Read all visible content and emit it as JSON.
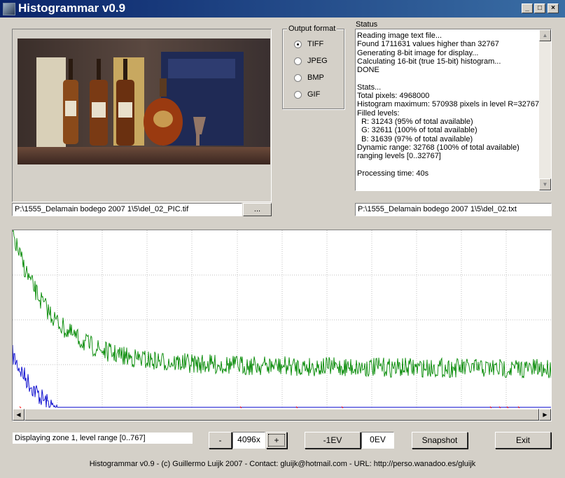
{
  "window": {
    "title": "Histogrammar v0.9",
    "controls": [
      "_",
      "□",
      "×"
    ]
  },
  "preview": {
    "file_path": "P:\\1555_Delamain bodego 2007 1\\5\\del_02_PIC.tif",
    "browse_label": "..."
  },
  "output_format": {
    "legend": "Output format",
    "options": [
      {
        "label": "TIFF",
        "selected": true
      },
      {
        "label": "JPEG",
        "selected": false
      },
      {
        "label": "BMP",
        "selected": false
      },
      {
        "label": "GIF",
        "selected": false
      }
    ]
  },
  "status": {
    "label": "Status",
    "lines": [
      "Reading image text file...",
      "Found 1711631 values higher than 32767",
      "Generating 8-bit image for display...",
      "Calculating 16-bit (true 15-bit) histogram...",
      "DONE",
      "",
      "Stats...",
      "Total pixels: 4968000",
      "Histogram maximum: 570938 pixels in level R=32767",
      "Filled levels:",
      "  R: 31243 (95% of total available)",
      "  G: 32611 (100% of total available)",
      "  B: 31639 (97% of total available)",
      "Dynamic range: 32768 (100% of total available)",
      "ranging levels [0..32767]",
      "",
      "Processing time: 40s"
    ],
    "text_file_path": "P:\\1555_Delamain bodego 2007 1\\5\\del_02.txt"
  },
  "histogram": {
    "series_colors": {
      "blue": "#0000cc",
      "green": "#008800",
      "red": "#ff0000"
    }
  },
  "controls": {
    "zone_info": "Displaying zone 1, level range [0..767]",
    "zoom_minus": "-",
    "zoom_value": "4096x",
    "zoom_plus": "+",
    "minus_ev": "-1EV",
    "ev_value": "0EV",
    "snapshot": "Snapshot",
    "exit": "Exit"
  },
  "footer": "Histogrammar v0.9 - (c) Guillermo Luijk 2007 - Contact: gluijk@hotmail.com - URL: http://perso.wanadoo.es/gluijk"
}
